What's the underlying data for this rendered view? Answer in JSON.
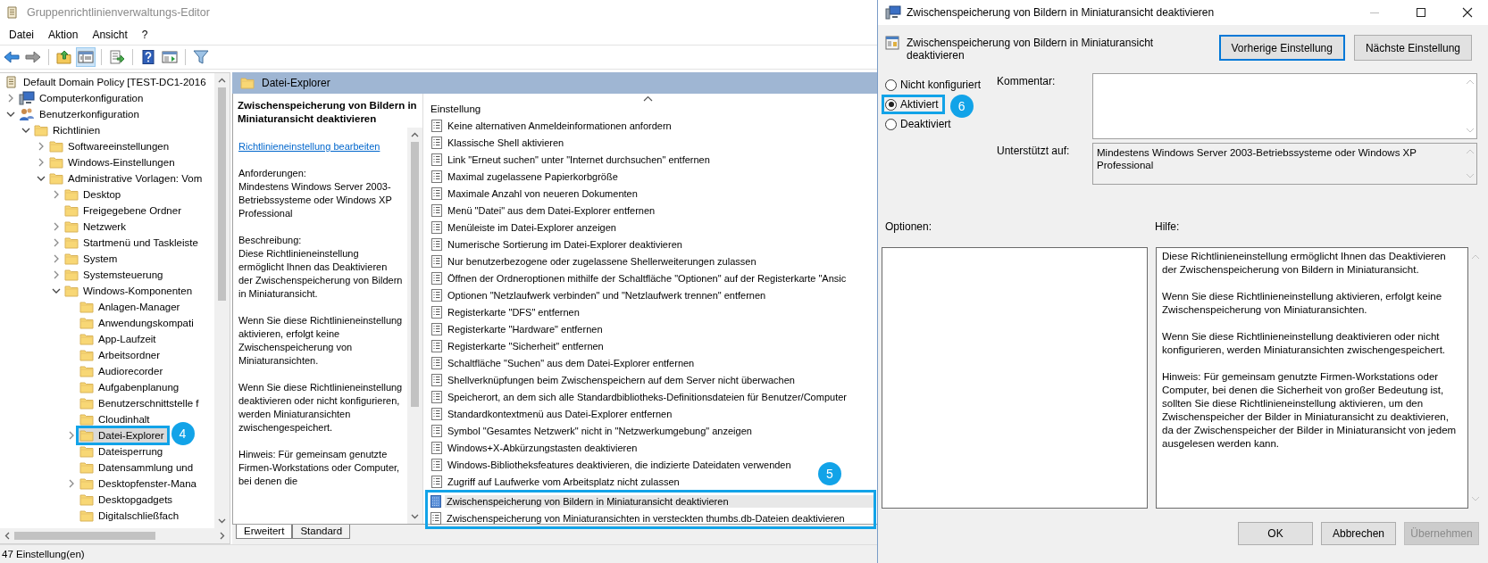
{
  "main_window": {
    "title": "Gruppenrichtlinienverwaltungs-Editor",
    "menu": [
      "Datei",
      "Aktion",
      "Ansicht",
      "?"
    ],
    "toolbar": [
      {
        "buttons": [
          {
            "kind": "back",
            "pressed": false
          },
          {
            "kind": "forward",
            "pressed": false
          }
        ]
      },
      {
        "buttons": [
          {
            "kind": "up",
            "pressed": false
          },
          {
            "kind": "tree",
            "pressed": true
          }
        ]
      },
      {
        "buttons": [
          {
            "kind": "export",
            "pressed": false
          }
        ]
      },
      {
        "buttons": [
          {
            "kind": "help",
            "pressed": false
          },
          {
            "kind": "view",
            "pressed": false
          }
        ]
      },
      {
        "buttons": [
          {
            "kind": "filter",
            "pressed": false
          }
        ]
      }
    ],
    "tree": [
      {
        "label": "Default Domain Policy [TEST-DC1-2016",
        "kind": "policy",
        "selected": false,
        "children": [
          {
            "label": "Computerkonfiguration",
            "kind": "computer",
            "expanded": false,
            "selected": false
          },
          {
            "label": "Benutzerkonfiguration",
            "kind": "user",
            "expanded": true,
            "selected": false,
            "children": [
              {
                "label": "Richtlinien",
                "kind": "folder",
                "expanded": true,
                "selected": false,
                "children": [
                  {
                    "label": "Softwareeinstellungen",
                    "kind": "folder",
                    "expanded": false,
                    "selected": false
                  },
                  {
                    "label": "Windows-Einstellungen",
                    "kind": "folder",
                    "expanded": false,
                    "selected": false
                  },
                  {
                    "label": "Administrative Vorlagen: Vom",
                    "kind": "folder",
                    "expanded": true,
                    "selected": false,
                    "children": [
                      {
                        "label": "Desktop",
                        "kind": "folder",
                        "expanded": false,
                        "selected": false
                      },
                      {
                        "label": "Freigegebene Ordner",
                        "kind": "folder",
                        "selected": false
                      },
                      {
                        "label": "Netzwerk",
                        "kind": "folder",
                        "expanded": false,
                        "selected": false
                      },
                      {
                        "label": "Startmenü und Taskleiste",
                        "kind": "folder",
                        "expanded": false,
                        "selected": false
                      },
                      {
                        "label": "System",
                        "kind": "folder",
                        "expanded": false,
                        "selected": false
                      },
                      {
                        "label": "Systemsteuerung",
                        "kind": "folder",
                        "expanded": false,
                        "selected": false
                      },
                      {
                        "label": "Windows-Komponenten",
                        "kind": "folder",
                        "expanded": true,
                        "selected": false,
                        "children": [
                          {
                            "label": "Anlagen-Manager",
                            "kind": "folder",
                            "selected": false
                          },
                          {
                            "label": "Anwendungskompati",
                            "kind": "folder",
                            "selected": false
                          },
                          {
                            "label": "App-Laufzeit",
                            "kind": "folder",
                            "selected": false
                          },
                          {
                            "label": "Arbeitsordner",
                            "kind": "folder",
                            "selected": false
                          },
                          {
                            "label": "Audiorecorder",
                            "kind": "folder",
                            "selected": false
                          },
                          {
                            "label": "Aufgabenplanung",
                            "kind": "folder",
                            "selected": false
                          },
                          {
                            "label": "Benutzerschnittstelle f",
                            "kind": "folder",
                            "selected": false
                          },
                          {
                            "label": "Cloudinhalt",
                            "kind": "folder",
                            "selected": false
                          },
                          {
                            "label": "Datei-Explorer",
                            "kind": "folder",
                            "expanded": false,
                            "selected": true,
                            "callout": "4"
                          },
                          {
                            "label": "Dateisperrung",
                            "kind": "folder",
                            "selected": false
                          },
                          {
                            "label": "Datensammlung und",
                            "kind": "folder",
                            "selected": false
                          },
                          {
                            "label": "Desktopfenster-Mana",
                            "kind": "folder",
                            "expanded": false,
                            "selected": false
                          },
                          {
                            "label": "Desktopgadgets",
                            "kind": "folder",
                            "selected": false
                          },
                          {
                            "label": "Digitalschließfach",
                            "kind": "folder",
                            "selected": false
                          }
                        ]
                      }
                    ]
                  }
                ]
              }
            ]
          }
        ]
      }
    ],
    "details": {
      "header": "Datei-Explorer",
      "title": "Zwischenspeicherung von Bildern in Miniaturansicht deaktivieren",
      "link": "Richtlinieneinstellung bearbeiten",
      "sections": [
        {
          "heading": "Anforderungen:",
          "text": "Mindestens Windows Server 2003-Betriebssysteme oder Windows XP Professional"
        },
        {
          "heading": "Beschreibung:",
          "text": "Diese Richtlinieneinstellung ermöglicht Ihnen das Deaktivieren der Zwischenspeicherung von Bildern in Miniaturansicht."
        },
        {
          "text": "Wenn Sie diese Richtlinieneinstellung aktivieren, erfolgt keine Zwischenspeicherung von Miniaturansichten."
        },
        {
          "text": "Wenn Sie diese Richtlinieneinstellung deaktivieren oder nicht konfigurieren, werden Miniaturansichten zwischengespeichert."
        },
        {
          "text": "Hinweis: Für gemeinsam genutzte Firmen-Workstations oder Computer, bei denen die"
        }
      ]
    },
    "settings": {
      "column": "Einstellung",
      "callout": "5",
      "rows": [
        {
          "label": "Keine alternativen Anmeldeinformationen anfordern",
          "selected": false,
          "framed": false
        },
        {
          "label": "Klassische Shell aktivieren",
          "selected": false,
          "framed": false
        },
        {
          "label": "Link \"Erneut suchen\" unter \"Internet durchsuchen\" entfernen",
          "selected": false,
          "framed": false
        },
        {
          "label": "Maximal zugelassene Papierkorbgröße",
          "selected": false,
          "framed": false
        },
        {
          "label": "Maximale Anzahl von neueren Dokumenten",
          "selected": false,
          "framed": false
        },
        {
          "label": "Menü \"Datei\" aus dem Datei-Explorer entfernen",
          "selected": false,
          "framed": false
        },
        {
          "label": "Menüleiste im Datei-Explorer anzeigen",
          "selected": false,
          "framed": false
        },
        {
          "label": "Numerische Sortierung im Datei-Explorer deaktivieren",
          "selected": false,
          "framed": false
        },
        {
          "label": "Nur benutzerbezogene oder zugelassene Shellerweiterungen zulassen",
          "selected": false,
          "framed": false
        },
        {
          "label": "Öffnen der Ordneroptionen mithilfe der Schaltfläche \"Optionen\" auf der Registerkarte \"Ansic",
          "selected": false,
          "framed": false
        },
        {
          "label": "Optionen \"Netzlaufwerk verbinden\" und \"Netzlaufwerk trennen\" entfernen",
          "selected": false,
          "framed": false
        },
        {
          "label": "Registerkarte \"DFS\" entfernen",
          "selected": false,
          "framed": false
        },
        {
          "label": "Registerkarte \"Hardware\" entfernen",
          "selected": false,
          "framed": false
        },
        {
          "label": "Registerkarte \"Sicherheit\" entfernen",
          "selected": false,
          "framed": false
        },
        {
          "label": "Schaltfläche \"Suchen\" aus dem Datei-Explorer entfernen",
          "selected": false,
          "framed": false
        },
        {
          "label": "Shellverknüpfungen beim Zwischenspeichern auf dem Server nicht überwachen",
          "selected": false,
          "framed": false
        },
        {
          "label": "Speicherort, an dem sich alle Standardbibliotheks-Definitionsdateien für Benutzer/Computer",
          "selected": false,
          "framed": false
        },
        {
          "label": "Standardkontextmenü aus Datei-Explorer entfernen",
          "selected": false,
          "framed": false
        },
        {
          "label": "Symbol \"Gesamtes Netzwerk\" nicht in \"Netzwerkumgebung\" anzeigen",
          "selected": false,
          "framed": false
        },
        {
          "label": "Windows+X-Abkürzungstasten deaktivieren",
          "selected": false,
          "framed": false
        },
        {
          "label": "Windows-Bibliotheksfeatures deaktivieren, die indizierte Dateidaten verwenden",
          "selected": false,
          "framed": false
        },
        {
          "label": "Zugriff auf Laufwerke vom Arbeitsplatz nicht zulassen",
          "selected": false,
          "framed": false
        },
        {
          "label": "Zwischenspeicherung von Bildern in Miniaturansicht deaktivieren",
          "selected": true,
          "framed": true
        },
        {
          "label": "Zwischenspeicherung von Miniaturansichten in versteckten thumbs.db-Dateien deaktivieren",
          "selected": false,
          "framed": true
        }
      ]
    },
    "view_tabs": [
      {
        "label": "Erweitert",
        "selected": true
      },
      {
        "label": "Standard",
        "selected": false
      }
    ],
    "status_bar": "47 Einstellung(en)"
  },
  "dialog": {
    "title": "Zwischenspeicherung von Bildern in Miniaturansicht deaktivieren",
    "heading": "Zwischenspeicherung von Bildern in Miniaturansicht deaktivieren",
    "nav_buttons": [
      {
        "label": "Vorherige Einstellung",
        "focused": true
      },
      {
        "label": "Nächste Einstellung",
        "focused": false
      }
    ],
    "states": [
      {
        "label": "Nicht konfiguriert",
        "selected": false,
        "framed": false
      },
      {
        "label": "Aktiviert",
        "selected": true,
        "framed": true
      },
      {
        "label": "Deaktiviert",
        "selected": false,
        "framed": false
      }
    ],
    "state_callout": "6",
    "comment_label": "Kommentar:",
    "supported_label": "Unterstützt auf:",
    "supported_text": "Mindestens Windows Server 2003-Betriebssysteme oder Windows XP Professional",
    "options_label": "Optionen:",
    "help_label": "Hilfe:",
    "help_paragraphs": [
      "Diese Richtlinieneinstellung ermöglicht Ihnen das Deaktivieren der Zwischenspeicherung von Bildern in Miniaturansicht.",
      "Wenn Sie diese Richtlinieneinstellung aktivieren, erfolgt keine Zwischenspeicherung von Miniaturansichten.",
      "Wenn Sie diese Richtlinieneinstellung deaktivieren oder nicht konfigurieren, werden Miniaturansichten zwischengespeichert.",
      "Hinweis: Für gemeinsam genutzte Firmen-Workstations oder Computer, bei denen die Sicherheit von großer Bedeutung ist, sollten Sie diese Richtlinieneinstellung aktivieren, um den Zwischenspeicher der Bilder in Miniaturansicht zu deaktivieren, da der Zwischenspeicher der Bilder in Miniaturansicht von jedem ausgelesen werden kann."
    ],
    "buttons": [
      {
        "label": "OK",
        "disabled": false
      },
      {
        "label": "Abbrechen",
        "disabled": false
      },
      {
        "label": "Übernehmen",
        "disabled": true
      }
    ]
  }
}
